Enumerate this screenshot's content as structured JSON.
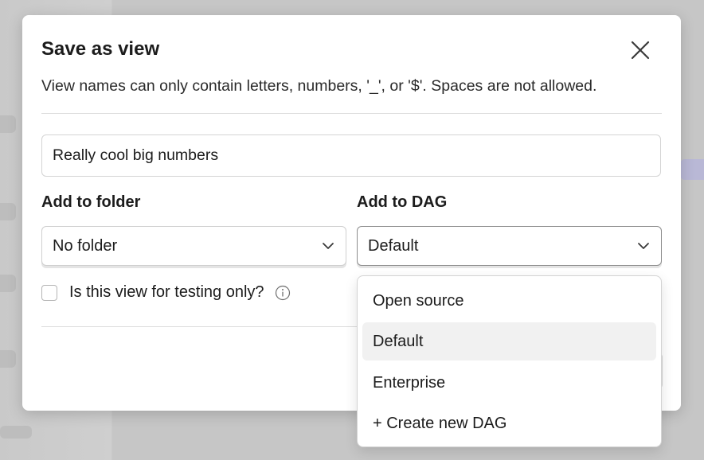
{
  "dialog": {
    "title": "Save as view",
    "subtitle": "View names can only contain letters, numbers, '_', or '$'. Spaces are not allowed.",
    "name_input": {
      "value": "Really cool big numbers",
      "placeholder": ""
    },
    "folder": {
      "label": "Add to folder",
      "selected": "No folder"
    },
    "dag": {
      "label": "Add to DAG",
      "selected": "Default"
    },
    "testing_checkbox": {
      "label": "Is this view for testing only?",
      "checked": false
    }
  },
  "dag_dropdown": {
    "options": [
      {
        "label": "Open source",
        "selected": false
      },
      {
        "label": "Default",
        "selected": true
      },
      {
        "label": "Enterprise",
        "selected": false
      },
      {
        "label": "+ Create new DAG",
        "selected": false
      }
    ]
  },
  "icons": {
    "close": "close-icon",
    "chevron": "chevron-down-icon",
    "info": "info-icon"
  },
  "colors": {
    "overlay": "#c4c4c4",
    "dialog_bg": "#ffffff",
    "text": "#1c1c1c",
    "selected_option_bg": "#f1f1f1"
  }
}
